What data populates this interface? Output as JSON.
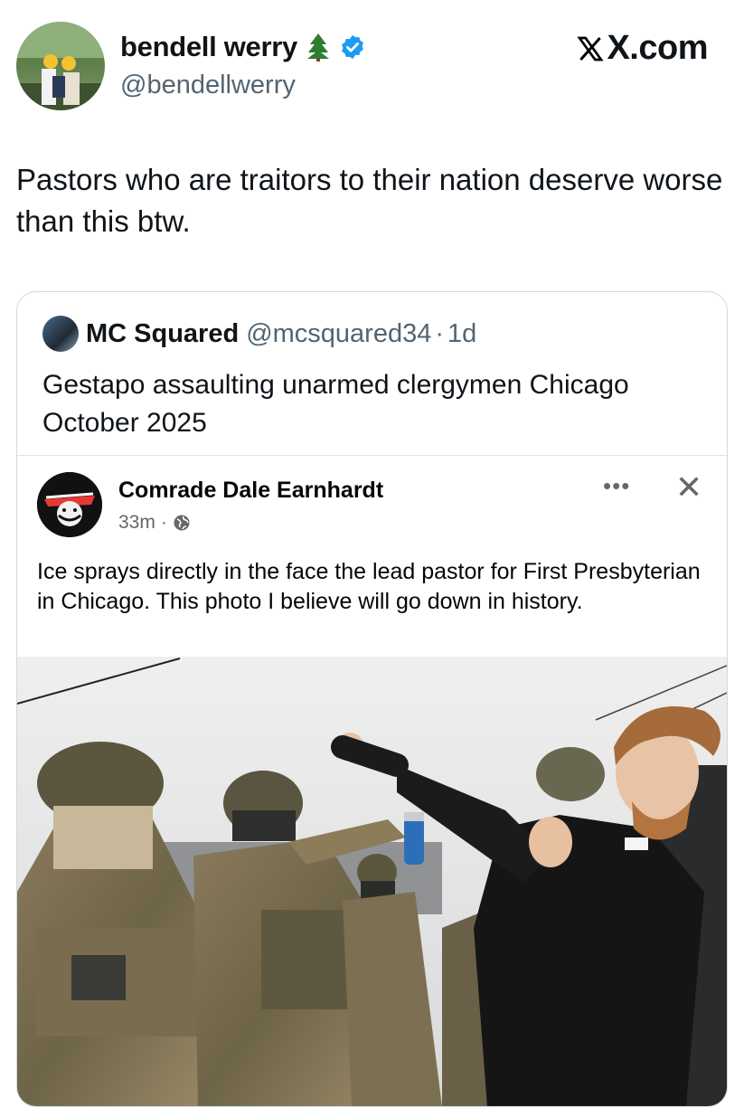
{
  "author": {
    "display_name": "bendell werry",
    "handle": "@bendellwerry",
    "name_emoji": "tree-icon",
    "verified": true
  },
  "brand": "X.com",
  "tweet": {
    "text": "Pastors who are traitors to their nation deserve worse than this btw."
  },
  "quote": {
    "name": "MC Squared",
    "handle": "@mcsquared34",
    "separator": "·",
    "age": "1d",
    "text": "Gestapo assaulting unarmed clergymen Chicago October 2025",
    "facebook_post": {
      "author": "Comrade Dale Earnhardt",
      "time": "33m",
      "separator": "·",
      "audience_icon": "globe-icon",
      "more_icon": "more-horizontal-icon",
      "close_icon": "close-icon",
      "text": "Ice sprays directly in the face the lead pastor for First Presbyterian in Chicago. This photo I believe will go down in history.",
      "photo": "photo of armed agents in camouflage tactical gear, one spraying a canister at a man in a black clerical shirt"
    }
  },
  "colors": {
    "text_primary": "#0f1419",
    "text_secondary": "#536471",
    "verified_blue": "#1d9bf0",
    "card_border": "#cfd9de",
    "fb_secondary": "#65676b"
  }
}
